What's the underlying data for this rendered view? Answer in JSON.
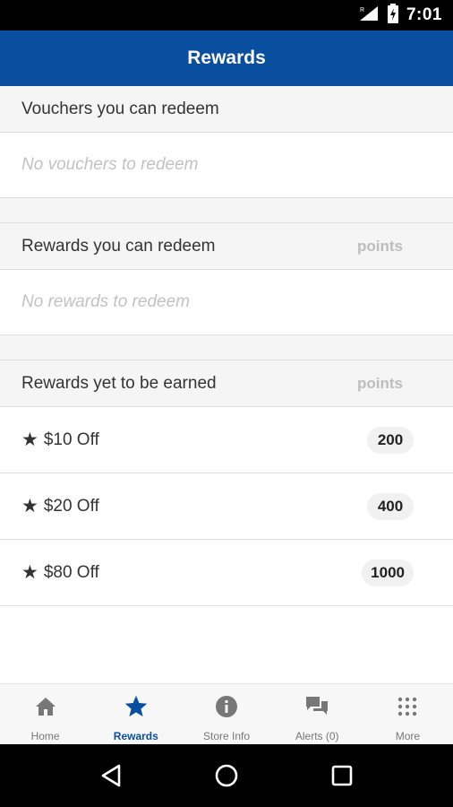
{
  "status_bar": {
    "time": "7:01"
  },
  "app_bar": {
    "title": "Rewards"
  },
  "vouchers": {
    "title": "Vouchers you can redeem",
    "empty": "No vouchers to redeem"
  },
  "redeemable": {
    "title": "Rewards you can redeem",
    "points_label": "points",
    "empty": "No rewards to redeem"
  },
  "to_earn": {
    "title": "Rewards yet to be earned",
    "points_label": "points",
    "items": [
      {
        "icon": "★",
        "name": "$10 Off",
        "points": "200"
      },
      {
        "icon": "★",
        "name": "$20 Off",
        "points": "400"
      },
      {
        "icon": "★",
        "name": "$80 Off",
        "points": "1000"
      }
    ]
  },
  "bottom_nav": {
    "items": [
      {
        "label": "Home",
        "icon": "home-icon"
      },
      {
        "label": "Rewards",
        "icon": "star-icon",
        "active": true
      },
      {
        "label": "Store Info",
        "icon": "info-icon"
      },
      {
        "label": "Alerts (0)",
        "icon": "chat-bubbles-icon"
      },
      {
        "label": "More",
        "icon": "grid-dots-icon"
      }
    ]
  },
  "colors": {
    "brand": "#0a4ea0",
    "muted": "#c2c2c2",
    "nav_inactive": "#777777"
  }
}
